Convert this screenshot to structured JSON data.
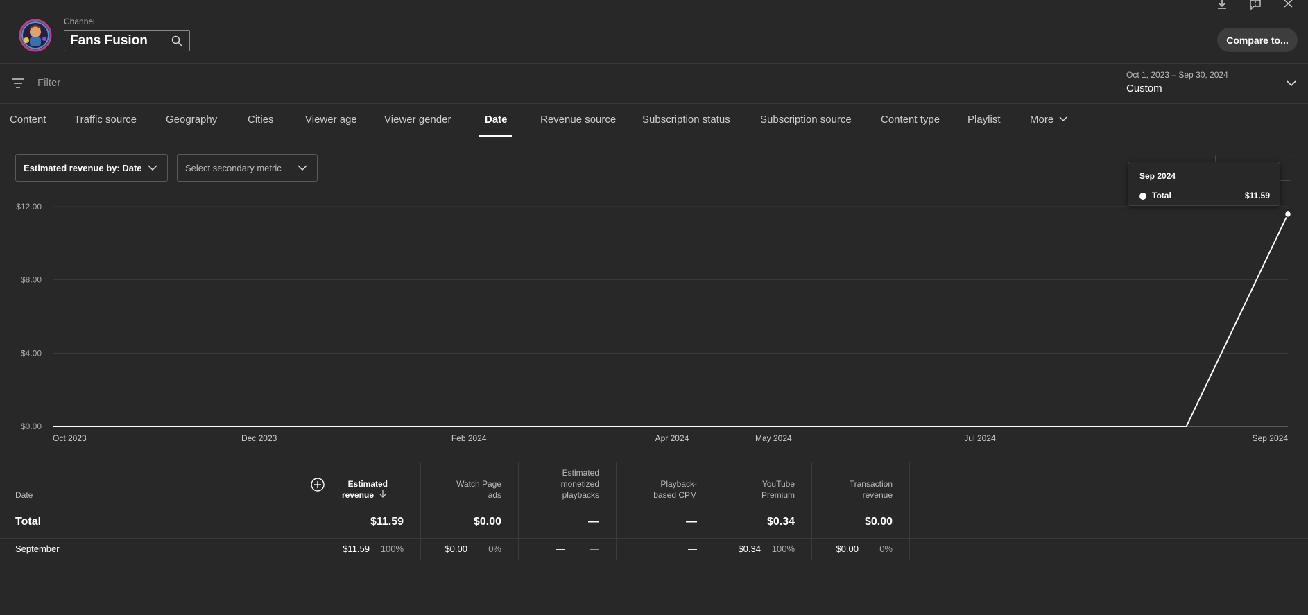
{
  "header": {
    "channel_label": "Channel",
    "channel_name": "Fans Fusion",
    "compare_label": "Compare to..."
  },
  "filter": {
    "placeholder": "Filter",
    "date_range": "Oct 1, 2023 – Sep 30, 2024",
    "date_preset": "Custom"
  },
  "tabs": [
    {
      "label": "Content"
    },
    {
      "label": "Traffic source"
    },
    {
      "label": "Geography"
    },
    {
      "label": "Cities"
    },
    {
      "label": "Viewer age"
    },
    {
      "label": "Viewer gender"
    },
    {
      "label": "Date"
    },
    {
      "label": "Revenue source"
    },
    {
      "label": "Subscription status"
    },
    {
      "label": "Subscription source"
    },
    {
      "label": "Content type"
    },
    {
      "label": "Playlist"
    },
    {
      "label": "More"
    }
  ],
  "active_tab": "Date",
  "metric_selector": {
    "primary": "Estimated revenue by: Date",
    "secondary": "Select secondary metric"
  },
  "chart_data": {
    "type": "line",
    "y_ticks": [
      "$0.00",
      "$4.00",
      "$8.00",
      "$12.00"
    ],
    "ylim": [
      0,
      12
    ],
    "x_ticks": [
      "Oct 2023",
      "Dec 2023",
      "Feb 2024",
      "Apr 2024",
      "May 2024",
      "Jul 2024",
      "Sep 2024"
    ],
    "x_dates": [
      "2023-10-01",
      "2023-12-01",
      "2024-02-01",
      "2024-04-01",
      "2024-05-01",
      "2024-07-01",
      "2024-09-30"
    ],
    "series": [
      {
        "name": "Total",
        "points": [
          [
            "2023-10-01",
            0
          ],
          [
            "2024-08-31",
            0
          ],
          [
            "2024-09-30",
            11.59
          ]
        ]
      }
    ],
    "grid": true,
    "line_color": "#ffffff"
  },
  "tooltip": {
    "title": "Sep 2024",
    "label": "Total",
    "value": "$11.59"
  },
  "table": {
    "date_header": "Date",
    "columns": [
      {
        "l1": "Estimated",
        "l2": "revenue"
      },
      {
        "l1": "Watch Page",
        "l2": "ads"
      },
      {
        "l1": "Estimated",
        "l2": "monetized",
        "l3": "playbacks"
      },
      {
        "l1": "Playback-",
        "l2": "based CPM"
      },
      {
        "l1": "YouTube",
        "l2": "Premium"
      },
      {
        "l1": "Transaction",
        "l2": "revenue"
      }
    ],
    "total": {
      "label": "Total",
      "values": [
        "$11.59",
        "$0.00",
        "—",
        "—",
        "$0.34",
        "$0.00"
      ]
    },
    "rows": [
      {
        "label": "September",
        "cells": [
          {
            "v": "$11.59",
            "p": "100%"
          },
          {
            "v": "$0.00",
            "p": "0%"
          },
          {
            "v": "—",
            "p": "—"
          },
          {
            "v": "—",
            "p": ""
          },
          {
            "v": "$0.34",
            "p": "100%"
          },
          {
            "v": "$0.00",
            "p": "0%"
          }
        ]
      }
    ]
  }
}
